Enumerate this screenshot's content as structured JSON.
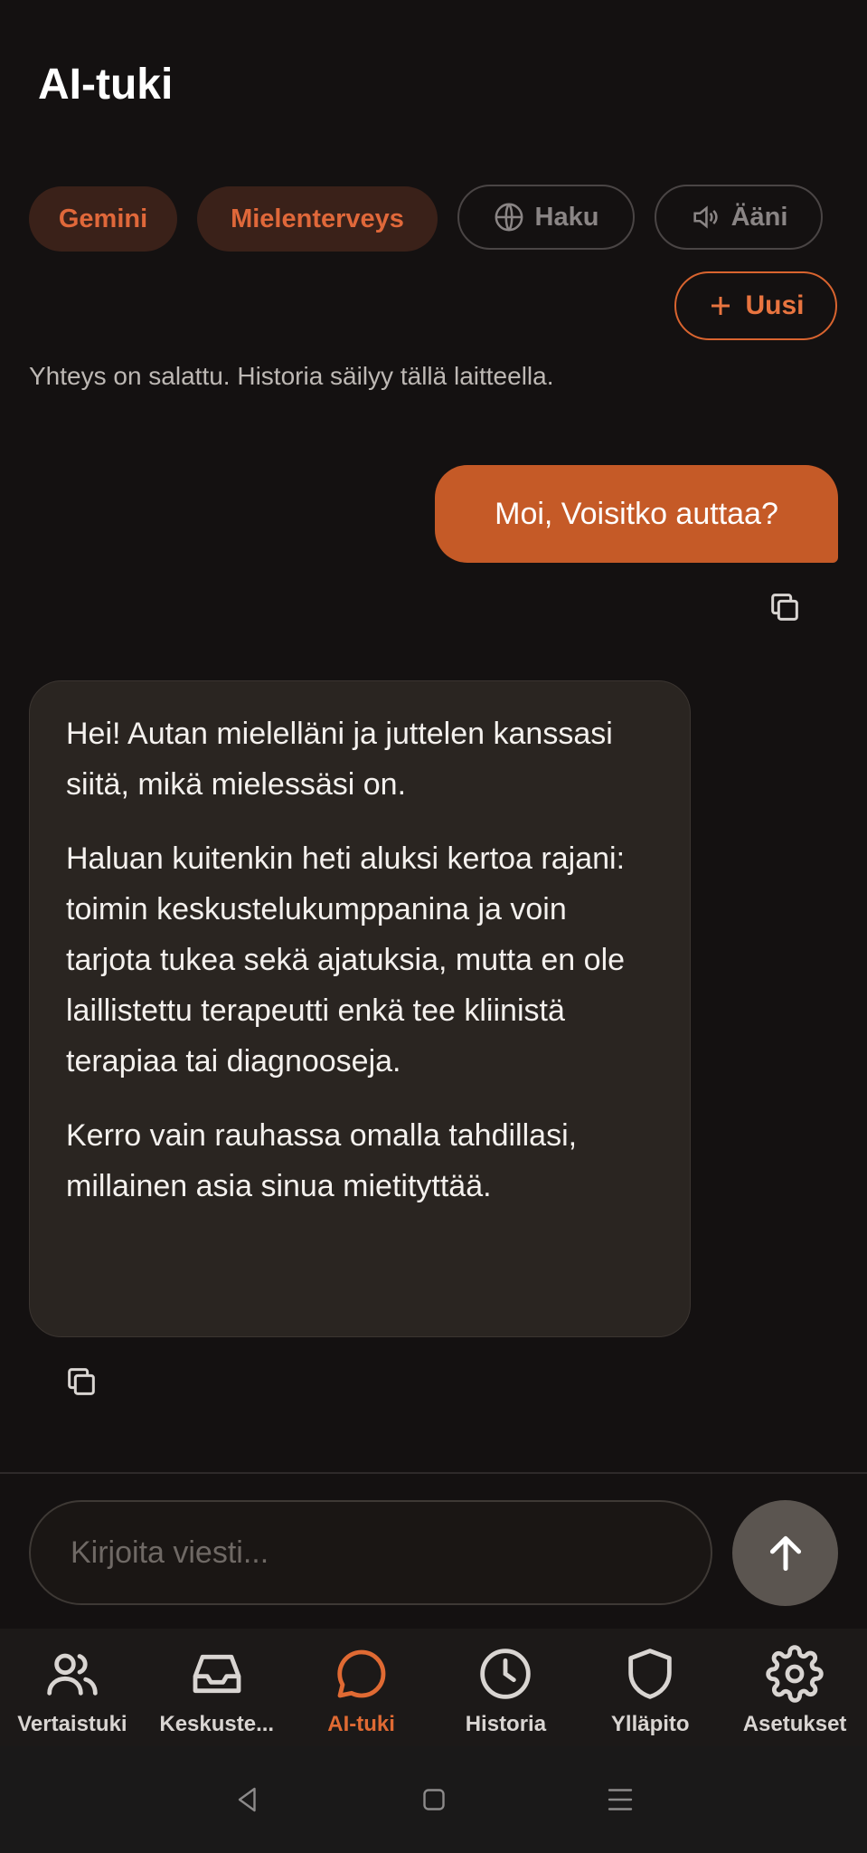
{
  "header": {
    "title": "AI-tuki"
  },
  "chips": [
    {
      "label": "Gemini",
      "active": true
    },
    {
      "label": "Mielenterveys",
      "active": true
    },
    {
      "label": "Haku",
      "active": false,
      "icon": "globe-icon"
    },
    {
      "label": "Ääni",
      "active": false,
      "icon": "speaker-icon"
    }
  ],
  "new_button": {
    "label": "Uusi",
    "icon": "plus-icon"
  },
  "notice": "Yhteys on salattu. Historia säilyy tällä laitteella.",
  "messages": {
    "user": "Moi, Voisitko auttaa?",
    "assistant": [
      "Hei! Autan mielelläni ja juttelen kanssasi siitä, mikä mielessäsi on.",
      "Haluan kuitenkin heti aluksi kertoa rajani: toimin keskustelukumppanina ja voin tarjota tukea sekä ajatuksia, mutta en ole laillistettu terapeutti enkä tee kliinistä terapiaa tai diagnooseja.",
      "Kerro vain rauhassa omalla tahdillasi, millainen asia sinua mietityttää."
    ]
  },
  "composer": {
    "placeholder": "Kirjoita viesti..."
  },
  "bottom_nav": [
    {
      "label": "Vertaistuki",
      "icon": "users-icon",
      "active": false
    },
    {
      "label": "Keskuste...",
      "icon": "inbox-icon",
      "active": false
    },
    {
      "label": "AI-tuki",
      "icon": "chat-bubble-icon",
      "active": true
    },
    {
      "label": "Historia",
      "icon": "clock-icon",
      "active": false
    },
    {
      "label": "Ylläpito",
      "icon": "shield-icon",
      "active": false
    },
    {
      "label": "Asetukset",
      "icon": "gear-icon",
      "active": false
    }
  ],
  "colors": {
    "accent": "#e0683a",
    "background": "#141111",
    "user_bubble": "#c55a27",
    "assistant_bubble": "#2a2521"
  }
}
